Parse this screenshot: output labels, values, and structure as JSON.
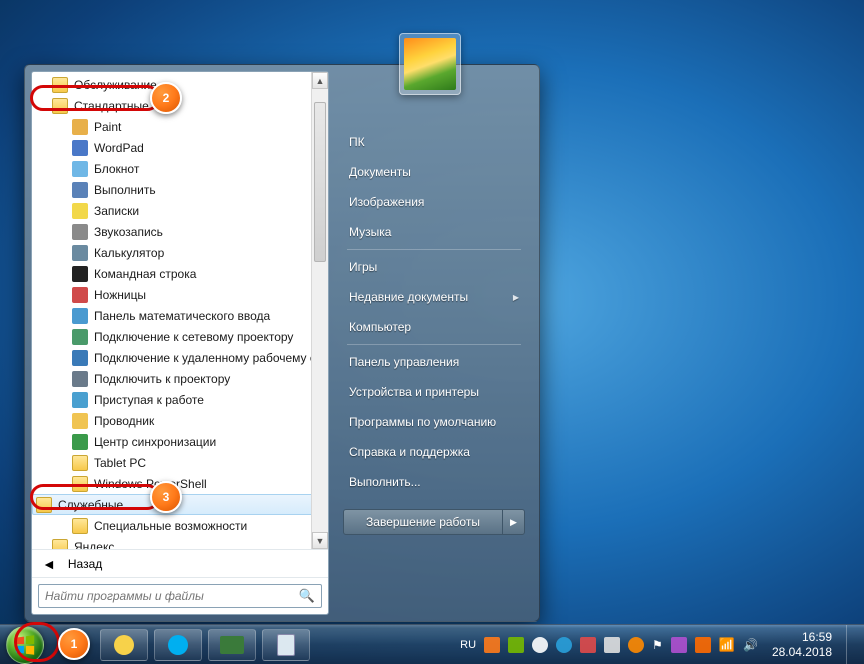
{
  "left": {
    "items": [
      {
        "label": "Обслуживание",
        "type": "folder",
        "indent": 1
      },
      {
        "label": "Стандартные",
        "type": "folder",
        "indent": 1,
        "ring": true,
        "callout": 2
      },
      {
        "label": "Paint",
        "type": "app",
        "indent": 2,
        "icon": "#e8b04a"
      },
      {
        "label": "WordPad",
        "type": "app",
        "indent": 2,
        "icon": "#4a78c8"
      },
      {
        "label": "Блокнот",
        "type": "app",
        "indent": 2,
        "icon": "#6fb7e6"
      },
      {
        "label": "Выполнить",
        "type": "app",
        "indent": 2,
        "icon": "#5a82b8"
      },
      {
        "label": "Записки",
        "type": "app",
        "indent": 2,
        "icon": "#f2d84a"
      },
      {
        "label": "Звукозапись",
        "type": "app",
        "indent": 2,
        "icon": "#8a8a8a"
      },
      {
        "label": "Калькулятор",
        "type": "app",
        "indent": 2,
        "icon": "#6a8aa0"
      },
      {
        "label": "Командная строка",
        "type": "app",
        "indent": 2,
        "icon": "#222"
      },
      {
        "label": "Ножницы",
        "type": "app",
        "indent": 2,
        "icon": "#d04a4a"
      },
      {
        "label": "Панель математического ввода",
        "type": "app",
        "indent": 2,
        "icon": "#4a9ad0"
      },
      {
        "label": "Подключение к сетевому проектору",
        "type": "app",
        "indent": 2,
        "icon": "#4a9a6a"
      },
      {
        "label": "Подключение к удаленному рабочему стол...",
        "type": "app",
        "indent": 2,
        "icon": "#3a7ab8"
      },
      {
        "label": "Подключить к проектору",
        "type": "app",
        "indent": 2,
        "icon": "#6a7a8a"
      },
      {
        "label": "Приступая к работе",
        "type": "app",
        "indent": 2,
        "icon": "#4aa0d0"
      },
      {
        "label": "Проводник",
        "type": "app",
        "indent": 2,
        "icon": "#f0c452"
      },
      {
        "label": "Центр синхронизации",
        "type": "app",
        "indent": 2,
        "icon": "#3a9a4a"
      },
      {
        "label": "Tablet PC",
        "type": "folder",
        "indent": 2
      },
      {
        "label": "Windows PowerShell",
        "type": "folder",
        "indent": 2
      },
      {
        "label": "Служебные",
        "type": "folder",
        "indent": 2,
        "hover": true,
        "ring": true,
        "callout": 3
      },
      {
        "label": "Специальные возможности",
        "type": "folder",
        "indent": 2
      },
      {
        "label": "Яндекс",
        "type": "folder",
        "indent": 1
      }
    ],
    "back": "Назад",
    "search_placeholder": "Найти программы и файлы"
  },
  "right": {
    "items": [
      {
        "label": "ПК"
      },
      {
        "label": "Документы"
      },
      {
        "label": "Изображения"
      },
      {
        "label": "Музыка"
      },
      {
        "sep": true
      },
      {
        "label": "Игры"
      },
      {
        "label": "Недавние документы",
        "arrow": true
      },
      {
        "label": "Компьютер"
      },
      {
        "sep": true
      },
      {
        "label": "Панель управления"
      },
      {
        "label": "Устройства и принтеры"
      },
      {
        "label": "Программы по умолчанию"
      },
      {
        "label": "Справка и поддержка"
      },
      {
        "label": "Выполнить..."
      }
    ],
    "shutdown": "Завершение работы"
  },
  "taskbar": {
    "lang": "RU",
    "time": "16:59",
    "date": "28.04.2018"
  },
  "callouts": {
    "start": 1
  }
}
